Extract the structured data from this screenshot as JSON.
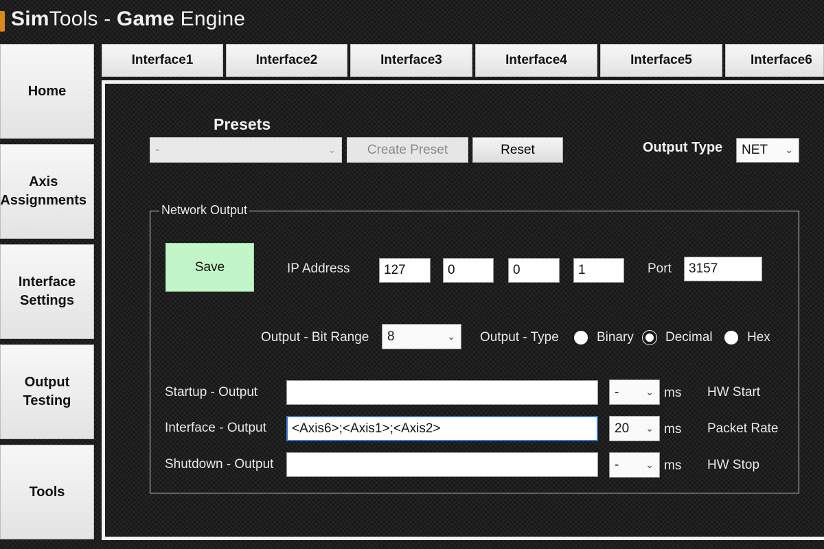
{
  "app": {
    "title_bold1": "Sim",
    "title_rest1": "Tools - ",
    "title_bold2": "Game",
    "title_rest2": " Engine"
  },
  "sidebar": {
    "items": [
      {
        "label": "Home"
      },
      {
        "label": "Axis\nAssignments"
      },
      {
        "label": "Interface\nSettings"
      },
      {
        "label": "Output\nTesting"
      },
      {
        "label": "Tools"
      }
    ]
  },
  "tabs": [
    {
      "label": "Interface1"
    },
    {
      "label": "Interface2"
    },
    {
      "label": "Interface3"
    },
    {
      "label": "Interface4"
    },
    {
      "label": "Interface5"
    },
    {
      "label": "Interface6"
    }
  ],
  "presets": {
    "title": "Presets",
    "selected": "-",
    "create_label": "Create Preset",
    "reset_label": "Reset"
  },
  "output_type": {
    "label": "Output Type",
    "selected": "NET"
  },
  "network": {
    "group_title": "Network Output",
    "save_label": "Save",
    "ip_label": "IP Address",
    "ip": [
      "127",
      "0",
      "0",
      "1"
    ],
    "port_label": "Port",
    "port": "3157",
    "bit_range_label": "Output - Bit Range",
    "bit_range": "8",
    "type_label": "Output - Type",
    "type_options": [
      "Binary",
      "Decimal",
      "Hex"
    ],
    "type_selected": "Decimal",
    "startup_label": "Startup - Output",
    "startup_value": "",
    "startup_ms": "-",
    "interface_label": "Interface - Output",
    "interface_value": "<Axis6>;<Axis1>;<Axis2>",
    "interface_ms": "20",
    "shutdown_label": "Shutdown - Output",
    "shutdown_value": "",
    "shutdown_ms": "-",
    "ms_unit": "ms",
    "hw_start": "HW Start",
    "packet_rate": "Packet Rate",
    "hw_stop": "HW Stop"
  },
  "colors": {
    "save_button": "#c2f5c8",
    "focus_border": "#3a78d4",
    "logo": "#d98a1a"
  }
}
